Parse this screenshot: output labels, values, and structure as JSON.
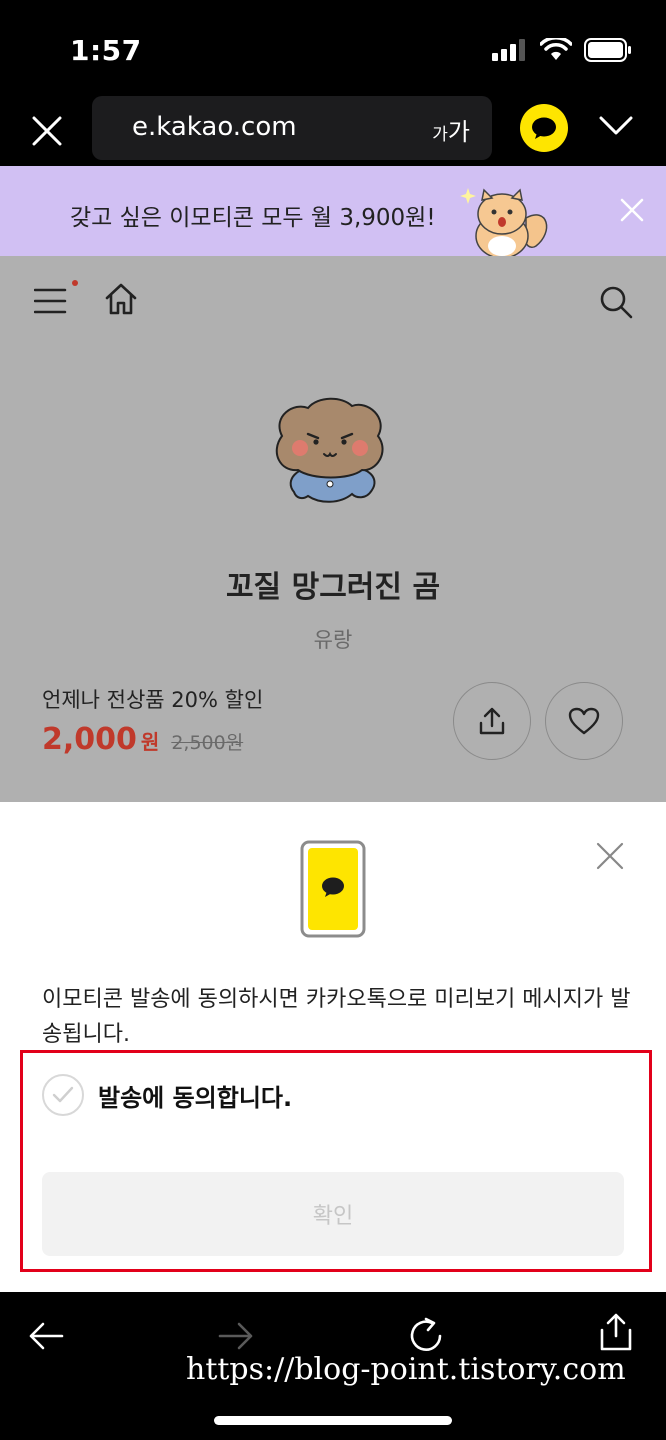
{
  "status": {
    "time": "1:57"
  },
  "browser": {
    "url": "e.kakao.com",
    "text_size_small": "가",
    "text_size_large": "가"
  },
  "promo": {
    "text": "갖고 싶은 이모티콘 모두 월 3,900원!"
  },
  "product": {
    "title": "꼬질 망그러진 곰",
    "author": "유랑",
    "discount_text": "언제나 전상품 20% 할인",
    "price": "2,000",
    "price_unit": "원",
    "original_price": "2,500원"
  },
  "sheet": {
    "description": "이모티콘 발송에 동의하시면 카카오톡으로 미리보기 메시지가 발송됩니다.",
    "agree_label": "발송에 동의합니다.",
    "agree_checked": false,
    "confirm_label": "확인"
  },
  "watermark": "https://blog-point.tistory.com",
  "colors": {
    "kakao_yellow": "#fee500",
    "promo_bg": "#d1c0f3",
    "price_red": "#c0392b",
    "highlight_red": "#e2001a"
  }
}
